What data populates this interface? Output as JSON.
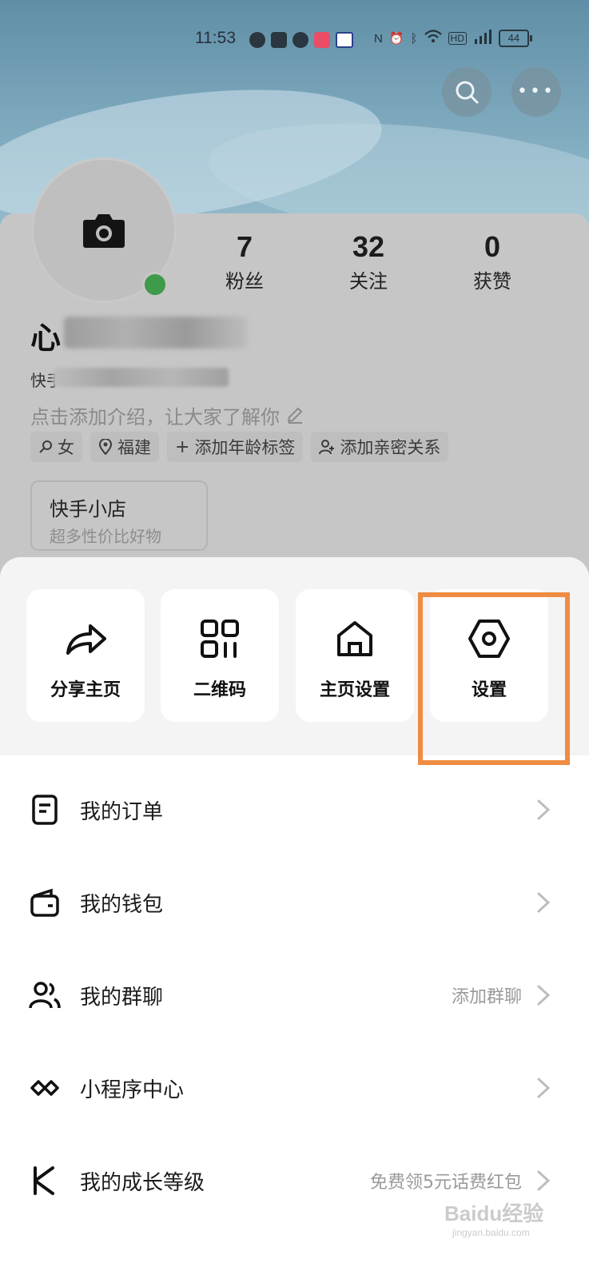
{
  "status_bar": {
    "time": "11:53",
    "battery": "44"
  },
  "profile": {
    "username": "心",
    "kuaishou_id_prefix": "快手",
    "intro_placeholder": "点击添加介绍，让大家了解你",
    "stats": [
      {
        "value": "7",
        "label": "粉丝"
      },
      {
        "value": "32",
        "label": "关注"
      },
      {
        "value": "0",
        "label": "获赞"
      }
    ],
    "tags": [
      {
        "icon": "gender-icon",
        "label": "女"
      },
      {
        "icon": "location-pin-icon",
        "label": "福建"
      },
      {
        "icon": "plus-icon",
        "label": "添加年龄标签"
      },
      {
        "icon": "person-add-icon",
        "label": "添加亲密关系"
      }
    ],
    "shop": {
      "title": "快手小店",
      "subtitle": "超多性价比好物"
    }
  },
  "actions": [
    {
      "label": "分享主页",
      "icon": "share-arrow-icon"
    },
    {
      "label": "二维码",
      "icon": "qr-code-icon"
    },
    {
      "label": "主页设置",
      "icon": "home-icon"
    },
    {
      "label": "设置",
      "icon": "settings-hexagon-icon"
    }
  ],
  "menu": [
    {
      "label": "我的订单",
      "hint": "",
      "icon": "order-icon"
    },
    {
      "label": "我的钱包",
      "hint": "",
      "icon": "wallet-icon"
    },
    {
      "label": "我的群聊",
      "hint": "添加群聊",
      "icon": "group-chat-icon"
    },
    {
      "label": "小程序中心",
      "hint": "",
      "icon": "mini-program-icon"
    },
    {
      "label": "我的成长等级",
      "hint": "免费领5元话费红包",
      "icon": "growth-level-icon"
    }
  ],
  "watermark": {
    "brand": "Baidu经验",
    "url": "jingyan.baidu.com"
  },
  "colors": {
    "highlight": "#ef8c43",
    "online": "#3f9a49"
  }
}
